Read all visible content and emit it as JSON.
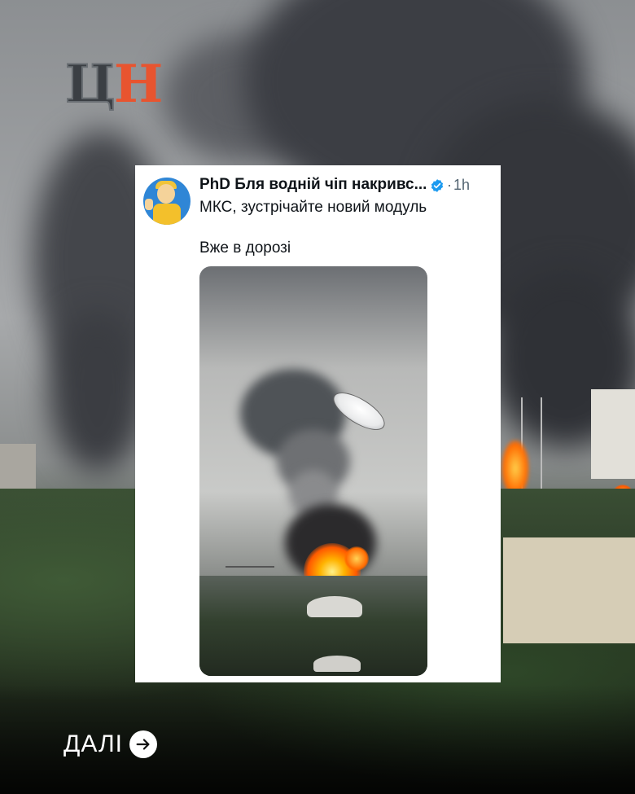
{
  "brand": {
    "logo_letters": [
      "Ц",
      "Н"
    ],
    "colors": {
      "logo_c": "#3b3f44",
      "logo_h": "#e8542f"
    }
  },
  "tweet": {
    "author_name": "PhD Бля водній чіп накривс...",
    "verified": true,
    "separator": "·",
    "timestamp": "1h",
    "text_line_1": "МКС, зустрічайте новий модуль",
    "text_line_2": "Вже в дорозі",
    "avatar_icon": "vault-boy-thumbs-up-avatar",
    "media_description_icon": "ufo-explosion-photo"
  },
  "footer": {
    "next_label": "ДАЛІ",
    "next_icon": "arrow-right-icon"
  }
}
